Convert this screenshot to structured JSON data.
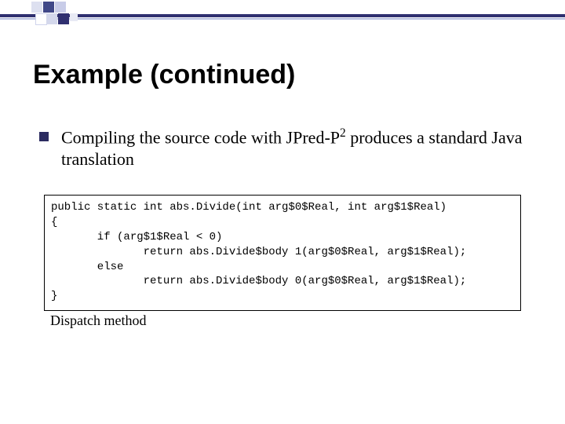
{
  "title": "Example (continued)",
  "bullet": {
    "prefix": "Compiling the source code with JPred-P",
    "sup": "2",
    "suffix": " produces a standard Java translation"
  },
  "code": {
    "l1": "public static int abs.Divide(int arg$0$Real, int arg$1$Real)",
    "l2": "{",
    "l3": "       if (arg$1$Real < 0)",
    "l4": "              return abs.Divide$body 1(arg$0$Real, arg$1$Real);",
    "l5": "       else",
    "l6": "              return abs.Divide$body 0(arg$0$Real, arg$1$Real);",
    "l7": "}"
  },
  "caption": "Dispatch method"
}
